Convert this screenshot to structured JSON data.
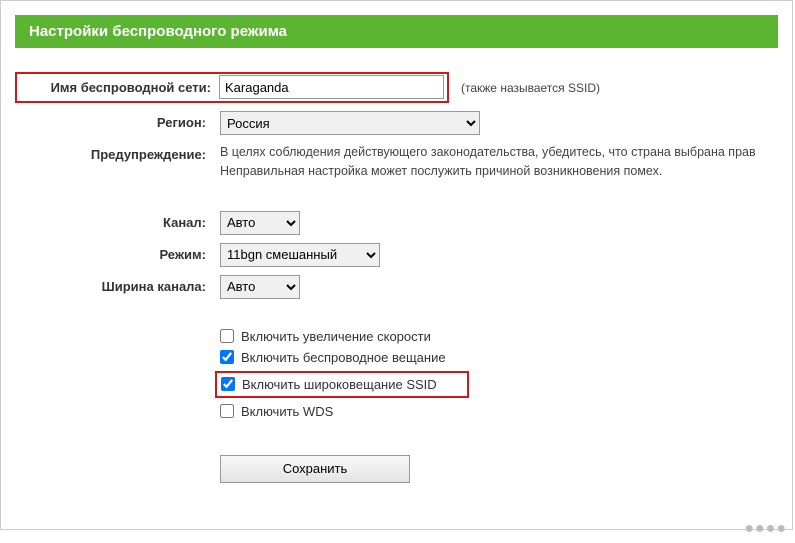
{
  "header": {
    "title": "Настройки беспроводного режима"
  },
  "labels": {
    "ssid": "Имя беспроводной сети:",
    "region": "Регион:",
    "warning_label": "Предупреждение:",
    "channel": "Канал:",
    "mode": "Режим:",
    "width": "Ширина канала:"
  },
  "fields": {
    "ssid_value": "Karaganda",
    "ssid_hint": "(также называется SSID)",
    "region_value": "Россия",
    "warning_text": "В целях соблюдения действующего законодательства, убедитесь, что страна выбрана прав\nНеправильная настройка может послужить причиной возникновения помех.",
    "channel_value": "Авто",
    "mode_value": "11bgn смешанный",
    "width_value": "Авто"
  },
  "checkboxes": {
    "speed_boost": {
      "label": "Включить увеличение скорости",
      "checked": false
    },
    "wireless_broadcast": {
      "label": "Включить беспроводное вещание",
      "checked": true
    },
    "ssid_broadcast": {
      "label": "Включить широковещание SSID",
      "checked": true
    },
    "wds": {
      "label": "Включить WDS",
      "checked": false
    }
  },
  "buttons": {
    "save": "Сохранить"
  }
}
